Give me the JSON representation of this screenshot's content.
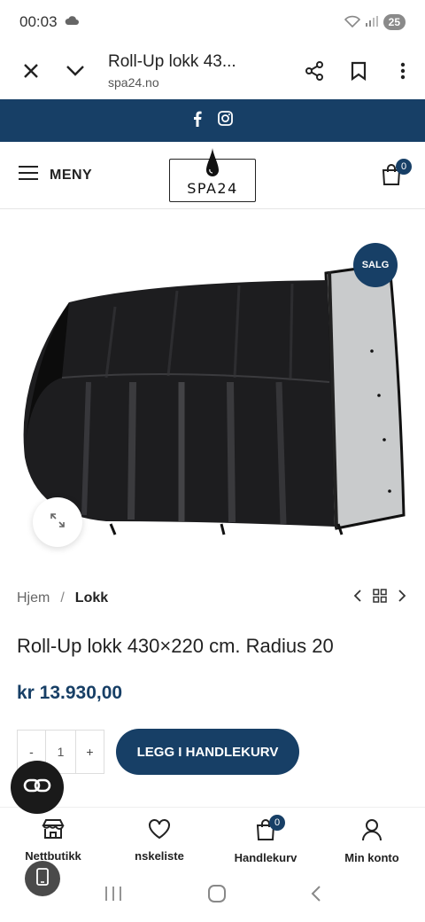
{
  "status_bar": {
    "time": "00:03",
    "battery": "25"
  },
  "browser": {
    "title": "Roll-Up lokk 43...",
    "url": "spa24.no"
  },
  "header": {
    "menu_label": "MENY",
    "logo_text": "SPA24",
    "cart_count": "0"
  },
  "product": {
    "sale_badge": "SALG",
    "title": "Roll-Up lokk 430×220 cm. Radius 20",
    "price": "kr 13.930,00",
    "quantity": "1",
    "qty_minus": "-",
    "qty_plus": "+",
    "add_to_cart": "LEGG I HANDLEKURV"
  },
  "breadcrumb": {
    "home": "Hjem",
    "separator": "/",
    "current": "Lokk"
  },
  "bottom_nav": {
    "items": [
      {
        "label": "Nettbutikk",
        "icon": "store-icon"
      },
      {
        "label": "nskeliste",
        "icon": "heart-icon"
      },
      {
        "label": "Handlekurv",
        "icon": "cart-icon",
        "badge": "0"
      },
      {
        "label": "Min konto",
        "icon": "user-icon"
      }
    ]
  },
  "colors": {
    "brand": "#173f66"
  }
}
